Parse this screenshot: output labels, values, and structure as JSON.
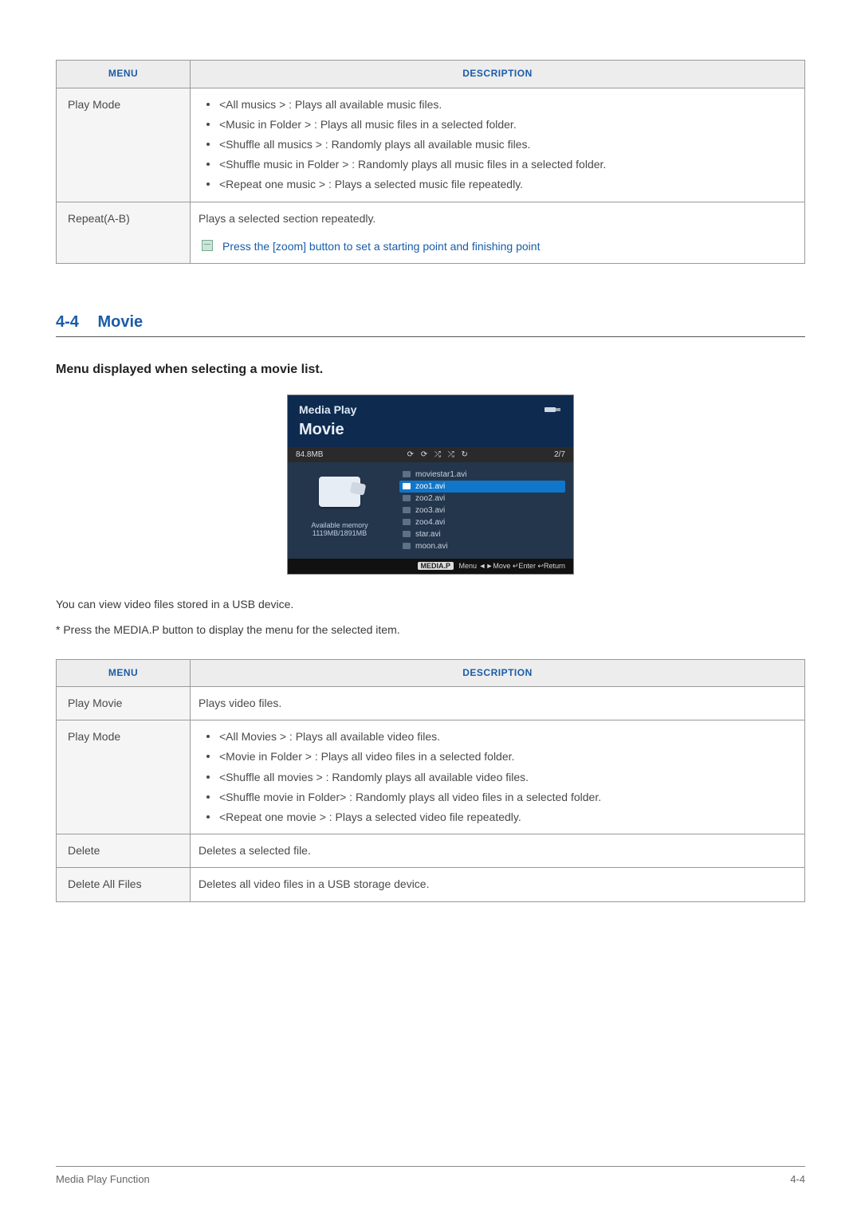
{
  "table1": {
    "headers": {
      "menu": "MENU",
      "desc": "DESCRIPTION"
    },
    "rows": [
      {
        "menu": "Play Mode",
        "bullets": [
          "<All musics > : Plays all available music files.",
          "<Music in Folder > : Plays all music files in a selected folder.",
          "<Shuffle all musics > : Randomly plays all available music files.",
          "<Shuffle music in Folder > : Randomly plays all music files in a selected folder.",
          "<Repeat one music > : Plays a selected music file repeatedly."
        ]
      },
      {
        "menu": "Repeat(A-B)",
        "plain": "Plays a selected section repeatedly.",
        "note": "Press the [zoom] button to set a starting point and finishing point"
      }
    ]
  },
  "section": {
    "num": "4-4",
    "title": "Movie"
  },
  "subheading": "Menu displayed when selecting a movie list.",
  "device": {
    "header": "Media Play",
    "sub": "Movie",
    "size": "84.8MB",
    "count": "2/7",
    "icons": "⟳ ⟳ ⤮ ⤮ ↻",
    "files": [
      "moviestar1.avi",
      "zoo1.avi",
      "zoo2.avi",
      "zoo3.avi",
      "zoo4.avi",
      "star.avi",
      "moon.avi"
    ],
    "sel_index": 1,
    "mem_label": "Available memory",
    "mem_value": "1119MB/1891MB",
    "footer_tag": "MEDIA.P",
    "footer_rest": "Menu   ◄►Move   ↵Enter   ↩Return"
  },
  "para1": "You can view video files stored in a USB device.",
  "para2": "* Press the MEDIA.P button to display the menu for the selected item.",
  "table2": {
    "headers": {
      "menu": "MENU",
      "desc": "DESCRIPTION"
    },
    "rows": [
      {
        "menu": "Play Movie",
        "plain": "Plays video files."
      },
      {
        "menu": "Play Mode",
        "bullets": [
          "<All Movies > : Plays all available video files.",
          "<Movie in Folder > : Plays all video files in a selected folder.",
          "<Shuffle all movies > : Randomly plays all available video files.",
          "<Shuffle movie in Folder> : Randomly plays all video files in a selected folder.",
          "<Repeat one movie > : Plays a selected video file repeatedly."
        ]
      },
      {
        "menu": "Delete",
        "plain": "Deletes a selected file."
      },
      {
        "menu": "Delete All Files",
        "plain": "Deletes all video files in a USB storage device."
      }
    ]
  },
  "footer": {
    "left": "Media Play Function",
    "right": "4-4"
  }
}
